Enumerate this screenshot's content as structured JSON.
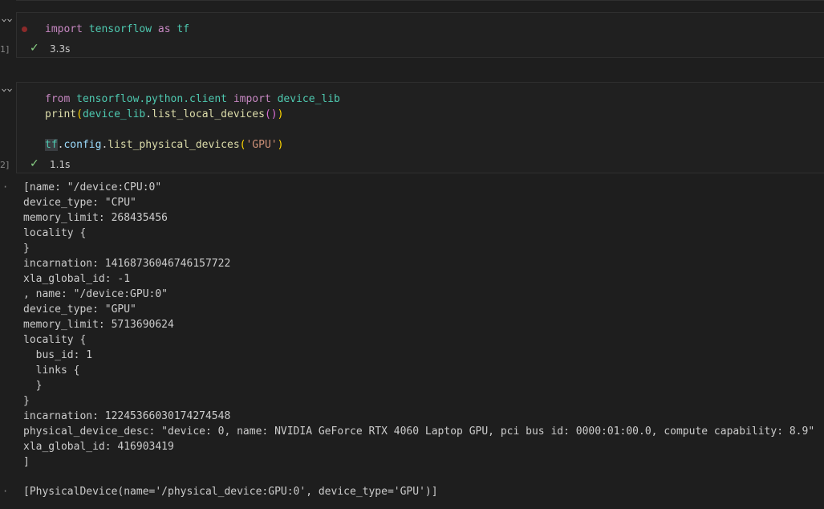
{
  "cell1": {
    "exec_count": "1]",
    "code": {
      "kw_import": "import",
      "module": "tensorflow",
      "kw_as": "as",
      "alias": "tf"
    },
    "status_time": "3.3s"
  },
  "cell2": {
    "exec_count": "2]",
    "line1": {
      "kw_from": "from",
      "module": "tensorflow.python.client",
      "kw_import": "import",
      "name": "device_lib"
    },
    "line2": {
      "fn_print": "print",
      "paren_open": "(",
      "obj": "device_lib",
      "dot": ".",
      "method": "list_local_devices",
      "inner_parens": "()",
      "paren_close": ")"
    },
    "line3": {
      "obj": "tf",
      "dot1": ".",
      "attr": "config",
      "dot2": ".",
      "method": "list_physical_devices",
      "paren_open": "(",
      "arg": "'GPU'",
      "paren_close": ")"
    },
    "status_time": "1.1s"
  },
  "output": {
    "text": "[name: \"/device:CPU:0\"\ndevice_type: \"CPU\"\nmemory_limit: 268435456\nlocality {\n}\nincarnation: 14168736046746157722\nxla_global_id: -1\n, name: \"/device:GPU:0\"\ndevice_type: \"GPU\"\nmemory_limit: 5713690624\nlocality {\n  bus_id: 1\n  links {\n  }\n}\nincarnation: 12245366030174274548\nphysical_device_desc: \"device: 0, name: NVIDIA GeForce RTX 4060 Laptop GPU, pci bus id: 0000:01:00.0, compute capability: 8.9\"\nxla_global_id: 416903419\n]",
    "result": "[PhysicalDevice(name='/physical_device:GPU:0', device_type='GPU')]"
  },
  "colors": {
    "background": "#1e1e1e",
    "keyword": "#c586c0",
    "module": "#4ec9b0",
    "function": "#dcdcaa",
    "string": "#ce9178",
    "success": "#89d185"
  },
  "icons": {
    "collapse": "chevron-down-icon",
    "success": "check-icon",
    "breakpoint": "breakpoint-dot-icon"
  }
}
